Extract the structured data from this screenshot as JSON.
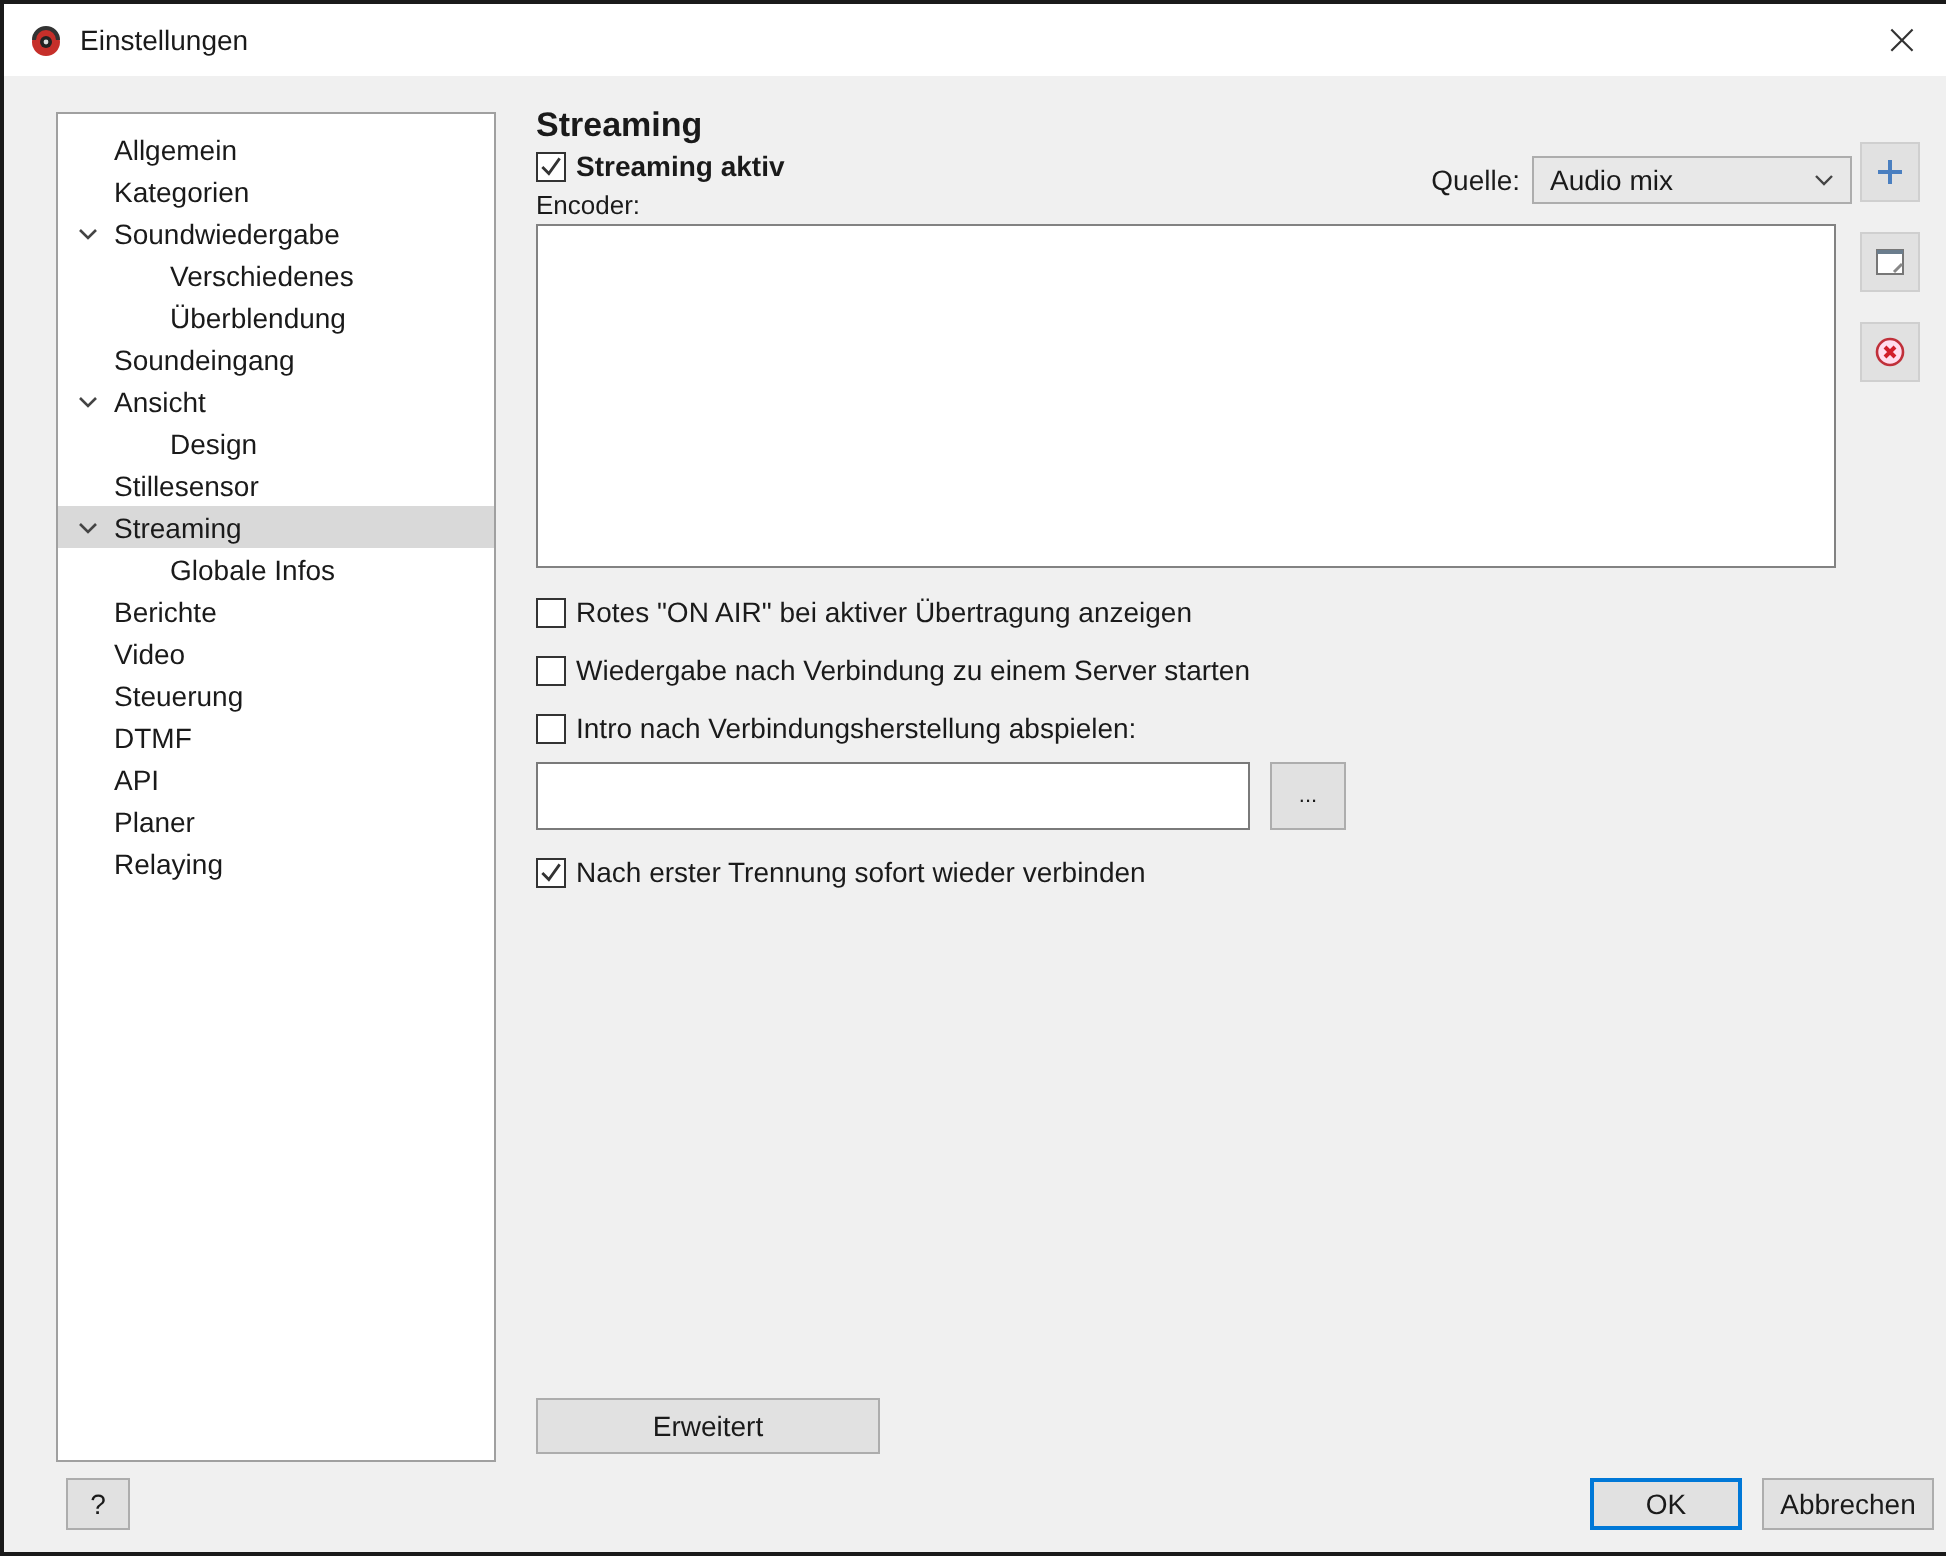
{
  "window": {
    "title": "Einstellungen",
    "close": "×"
  },
  "sidebar": {
    "items": [
      {
        "label": "Allgemein",
        "selected": false
      },
      {
        "label": "Kategorien",
        "selected": false
      },
      {
        "label": "Soundwiedergabe",
        "selected": false,
        "expanded": true,
        "children": [
          {
            "label": "Verschiedenes",
            "selected": false
          },
          {
            "label": "Überblendung",
            "selected": false
          }
        ]
      },
      {
        "label": "Soundeingang",
        "selected": false
      },
      {
        "label": "Ansicht",
        "selected": false,
        "expanded": true,
        "children": [
          {
            "label": "Design",
            "selected": false
          }
        ]
      },
      {
        "label": "Stillesensor",
        "selected": false
      },
      {
        "label": "Streaming",
        "selected": true,
        "expanded": true,
        "children": [
          {
            "label": "Globale Infos",
            "selected": false
          }
        ]
      },
      {
        "label": "Berichte",
        "selected": false
      },
      {
        "label": "Video",
        "selected": false
      },
      {
        "label": "Steuerung",
        "selected": false
      },
      {
        "label": "DTMF",
        "selected": false
      },
      {
        "label": "API",
        "selected": false
      },
      {
        "label": "Planer",
        "selected": false
      },
      {
        "label": "Relaying",
        "selected": false
      }
    ]
  },
  "panel": {
    "heading": "Streaming",
    "streaming_active": {
      "label": "Streaming aktiv",
      "checked": true
    },
    "source": {
      "label": "Quelle:",
      "value": "Audio mix"
    },
    "encoder_label": "Encoder:",
    "options": [
      {
        "label": "Rotes \"ON AIR\" bei aktiver Übertragung anzeigen",
        "checked": false
      },
      {
        "label": "Wiedergabe nach Verbindung zu einem Server starten",
        "checked": false
      },
      {
        "label": "Intro nach Verbindungsherstellung abspielen:",
        "checked": false
      }
    ],
    "browse_button": "...",
    "reconnect": {
      "label": "Nach erster Trennung sofort wieder verbinden",
      "checked": true
    },
    "advanced_button": "Erweitert"
  },
  "buttons": {
    "help": "?",
    "ok": "OK",
    "cancel": "Abbrechen"
  }
}
